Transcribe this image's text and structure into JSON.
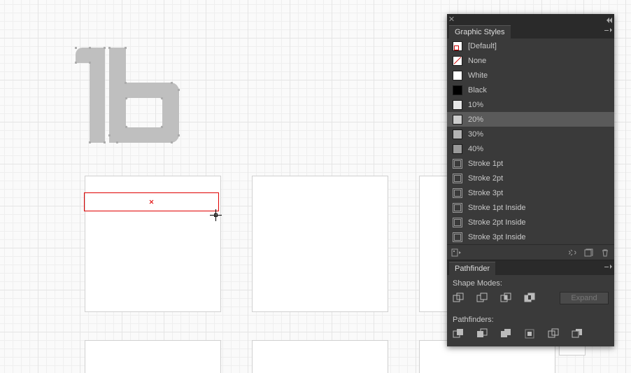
{
  "panels": {
    "graphic_styles": {
      "tab_label": "Graphic Styles",
      "items": [
        {
          "label": "[Default]",
          "swatch": "def"
        },
        {
          "label": "None",
          "swatch": "none"
        },
        {
          "label": "White",
          "swatch": "white"
        },
        {
          "label": "Black",
          "swatch": "black"
        },
        {
          "label": "10%",
          "swatch": "g10"
        },
        {
          "label": "20%",
          "swatch": "g20",
          "selected": true
        },
        {
          "label": "30%",
          "swatch": "g30"
        },
        {
          "label": "40%",
          "swatch": "g40"
        },
        {
          "label": "Stroke 1pt",
          "swatch": "stroke"
        },
        {
          "label": "Stroke 2pt",
          "swatch": "stroke"
        },
        {
          "label": "Stroke 3pt",
          "swatch": "stroke"
        },
        {
          "label": "Stroke 1pt Inside",
          "swatch": "stroke"
        },
        {
          "label": "Stroke 2pt Inside",
          "swatch": "stroke"
        },
        {
          "label": "Stroke 3pt Inside",
          "swatch": "stroke"
        }
      ]
    },
    "pathfinder": {
      "tab_label": "Pathfinder",
      "shape_modes_label": "Shape Modes:",
      "pathfinders_label": "Pathfinders:",
      "expand_label": "Expand"
    }
  }
}
